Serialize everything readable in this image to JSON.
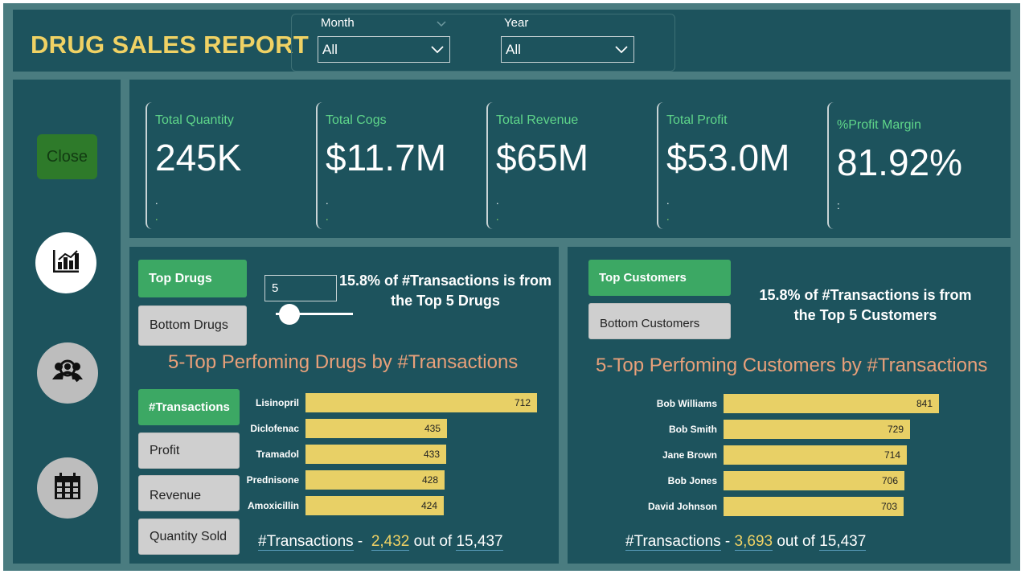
{
  "header": {
    "title": "DRUG SALES REPORT",
    "filters": [
      {
        "label": "Month",
        "value": "All"
      },
      {
        "label": "Year",
        "value": "All"
      }
    ]
  },
  "sidebar": {
    "close_label": "Close",
    "nav": [
      {
        "icon": "bar-chart-icon",
        "active": true
      },
      {
        "icon": "customer-search-icon",
        "active": false
      },
      {
        "icon": "calendar-icon",
        "active": false
      }
    ]
  },
  "kpis": [
    {
      "label": "Total Quantity",
      "value": "245K",
      "line1": ".",
      "line2": "."
    },
    {
      "label": "Total Cogs",
      "value": "$11.7M",
      "line1": ".",
      "line2": "."
    },
    {
      "label": "Total Revenue",
      "value": "$65M",
      "line1": ".",
      "line2": "."
    },
    {
      "label": "Total Profit",
      "value": "$53.0M",
      "line1": ".",
      "line2": "."
    },
    {
      "label": "%Profit Margin",
      "value": "81.92%",
      "line1": ":",
      "line2": ""
    }
  ],
  "drugs": {
    "top_button": "Top Drugs",
    "bottom_button": "Bottom Drugs",
    "n_input": "5",
    "insight_line1": "15.8% of #Transactions is from",
    "insight_line2": "the Top 5 Drugs",
    "chart_title": "5-Top Perfoming Drugs by #Transactions",
    "metric_buttons": [
      "#Transactions",
      "Profit",
      "Revenue",
      "Quantity Sold"
    ],
    "footer": {
      "prefix": "#Transactions",
      "sep": " - ",
      "value": "2,432",
      "mid": " out of ",
      "total": "15,437"
    }
  },
  "customers": {
    "top_button": "Top Customers",
    "bottom_button": "Bottom Customers",
    "insight_line1": "15.8% of #Transactions is from",
    "insight_line2": "the Top 5 Customers",
    "chart_title": "5-Top Perfoming Customers by #Transactions",
    "footer": {
      "prefix": "#Transactions",
      "sep": " - ",
      "value": "3,693",
      "mid": " out of ",
      "total": "15,437"
    }
  },
  "colors": {
    "bar": "#e8d066",
    "accent_green": "#3ca864",
    "title_yellow": "#f0d264",
    "chart_title": "#e8a07a"
  },
  "chart_data": [
    {
      "type": "bar",
      "orientation": "horizontal",
      "title": "5-Top Perfoming Drugs by #Transactions",
      "categories": [
        "Lisinopril",
        "Diclofenac",
        "Tramadol",
        "Prednisone",
        "Amoxicillin"
      ],
      "values": [
        712,
        435,
        433,
        428,
        424
      ]
    },
    {
      "type": "bar",
      "orientation": "horizontal",
      "title": "5-Top Perfoming Customers by #Transactions",
      "categories": [
        "Bob Williams",
        "Bob Smith",
        "Jane Brown",
        "Bob Jones",
        "David Johnson"
      ],
      "values": [
        841,
        729,
        714,
        706,
        703
      ]
    }
  ]
}
